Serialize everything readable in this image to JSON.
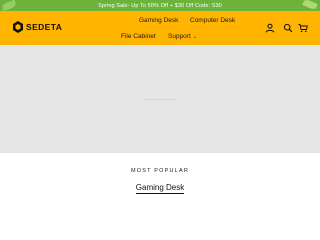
{
  "announcement": {
    "text": "Spring Sale- Up To 50% Off + $30 Off Code: S30"
  },
  "header": {
    "brand": "SEDETA",
    "nav": [
      {
        "label": "Gaming Desk"
      },
      {
        "label": "Computer Desk"
      },
      {
        "label": "File Cabinet"
      },
      {
        "label": "Support",
        "has_dropdown": true
      }
    ],
    "icons": [
      "account-icon",
      "search-icon",
      "cart-icon"
    ]
  },
  "colors": {
    "announcement_bg": "#6bb33a",
    "header_bg": "#ffb400",
    "hero_bg": "#e5e5e5"
  },
  "section": {
    "kicker": "MOST POPULAR",
    "title": "Gaming Desk"
  }
}
